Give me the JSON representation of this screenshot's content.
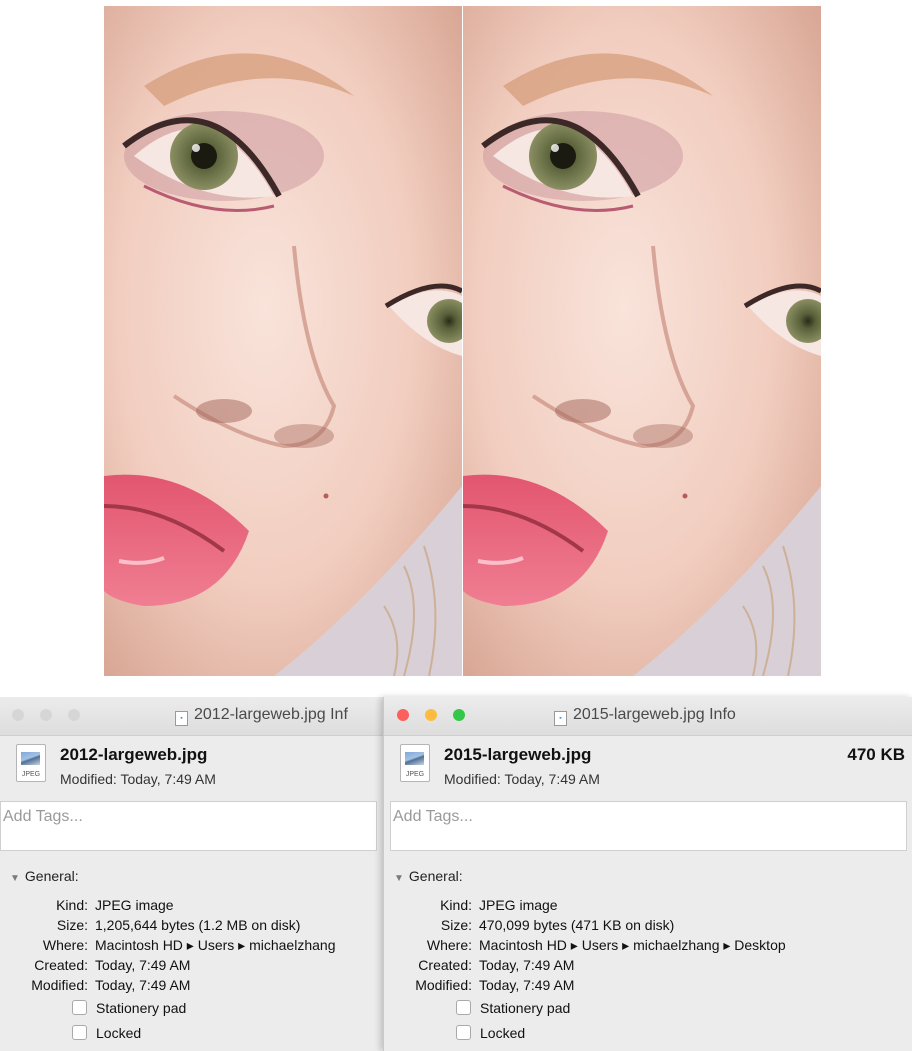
{
  "windows": [
    {
      "title": "2012-largeweb.jpg Inf",
      "filename": "2012-largeweb.jpg",
      "modified_header": "Modified: Today, 7:49 AM",
      "size_header": "",
      "icon_label": "JPEG",
      "tags_placeholder": "Add Tags...",
      "general_label": "General:",
      "info": {
        "kind_label": "Kind:",
        "kind": "JPEG image",
        "size_label": "Size:",
        "size": "1,205,644 bytes (1.2 MB on disk)",
        "where_label": "Where:",
        "where": "Macintosh HD ▸ Users ▸ michaelzhang",
        "created_label": "Created:",
        "created": "Today, 7:49 AM",
        "modified_label": "Modified:",
        "modified": "Today, 7:49 AM"
      },
      "stationery_label": "Stationery pad",
      "locked_label": "Locked",
      "active": false
    },
    {
      "title": "2015-largeweb.jpg Info",
      "filename": "2015-largeweb.jpg",
      "modified_header": "Modified: Today, 7:49 AM",
      "size_header": "470 KB",
      "icon_label": "JPEG",
      "tags_placeholder": "Add Tags...",
      "general_label": "General:",
      "info": {
        "kind_label": "Kind:",
        "kind": "JPEG image",
        "size_label": "Size:",
        "size": "470,099 bytes (471 KB on disk)",
        "where_label": "Where:",
        "where": "Macintosh HD ▸ Users ▸ michaelzhang ▸ Desktop",
        "created_label": "Created:",
        "created": "Today, 7:49 AM",
        "modified_label": "Modified:",
        "modified": "Today, 7:49 AM"
      },
      "stationery_label": "Stationery pad",
      "locked_label": "Locked",
      "active": true
    }
  ],
  "colors": {
    "close": "#fc605c",
    "minimize": "#fdbc40",
    "zoom": "#34c84a",
    "inactive_light": "#d6d6d6",
    "skin": "#f3d2c7",
    "lips": "#e4536f"
  }
}
